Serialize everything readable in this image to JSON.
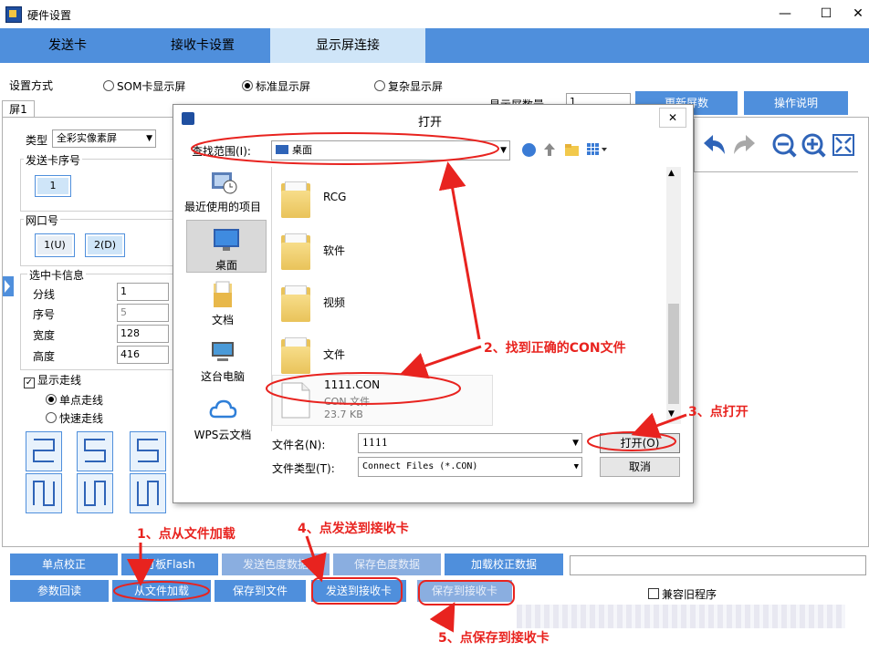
{
  "window": {
    "title": "硬件设置",
    "minimize": "—",
    "maximize": "☐",
    "close": "✕"
  },
  "tabs": [
    {
      "label": "发送卡"
    },
    {
      "label": "接收卡设置"
    },
    {
      "label": "显示屏连接"
    }
  ],
  "setup": {
    "mode_label": "设置方式",
    "modes": [
      {
        "label": "SOM卡显示屏",
        "selected": false
      },
      {
        "label": "标准显示屏",
        "selected": true
      },
      {
        "label": "复杂显示屏",
        "selected": false
      }
    ],
    "screen_count_label": "显示屏数量",
    "screen_count_value": "1",
    "btn_refresh": "更新屏数",
    "btn_help": "操作说明"
  },
  "screen_tab": "屏1",
  "left_panel": {
    "type_label": "类型",
    "type_value": "全彩实像素屏",
    "sender_group": "发送卡序号",
    "sender_value": "1",
    "port_group": "网口号",
    "port_1": "1(U)",
    "port_2": "2(D)",
    "selected_group": "选中卡信息",
    "fields": [
      {
        "label": "分线",
        "value": "1"
      },
      {
        "label": "序号",
        "value": "5"
      },
      {
        "label": "宽度",
        "value": "128"
      },
      {
        "label": "高度",
        "value": "416"
      }
    ],
    "show_wiring": "显示走线",
    "wiring_single": "单点走线",
    "wiring_fast": "快速走线"
  },
  "bottom_row1": [
    {
      "label": "单点校正",
      "enabled": true
    },
    {
      "label": "灯板Flash",
      "enabled": true
    },
    {
      "label": "发送色度数据",
      "enabled": false
    },
    {
      "label": "保存色度数据",
      "enabled": false
    },
    {
      "label": "加载校正数据",
      "enabled": true
    }
  ],
  "bottom_row2": [
    {
      "label": "参数回读",
      "enabled": true
    },
    {
      "label": "从文件加载",
      "enabled": true
    },
    {
      "label": "保存到文件",
      "enabled": true
    },
    {
      "label": "发送到接收卡",
      "enabled": true
    },
    {
      "label": "保存到接收卡",
      "enabled": false
    }
  ],
  "compat_label": "兼容旧程序",
  "dialog": {
    "title": "打开",
    "close": "✕",
    "lookin_label": "查找范围(I):",
    "lookin_value": "桌面",
    "sidebar": [
      {
        "label": "最近使用的项目",
        "icon": "recent-items-icon"
      },
      {
        "label": "桌面",
        "icon": "desktop-icon"
      },
      {
        "label": "文档",
        "icon": "documents-icon"
      },
      {
        "label": "这台电脑",
        "icon": "this-pc-icon"
      },
      {
        "label": "WPS云文档",
        "icon": "wps-cloud-icon"
      }
    ],
    "files": [
      {
        "name": "RCG",
        "kind": "folder"
      },
      {
        "name": "软件",
        "kind": "folder"
      },
      {
        "name": "视频",
        "kind": "folder"
      },
      {
        "name": "文件",
        "kind": "folder"
      }
    ],
    "selected_file": {
      "name": "1111.CON",
      "type": "CON 文件",
      "size": "23.7 KB"
    },
    "filename_label": "文件名(N):",
    "filename_value": "1111",
    "filetype_label": "文件类型(T):",
    "filetype_value": "Connect Files (*.CON)",
    "open_button": "打开(O)",
    "cancel_button": "取消"
  },
  "annotations": {
    "step1": "1、点从文件加载",
    "step2": "2、找到正确的CON文件",
    "step3": "3、点打开",
    "step4": "4、点发送到接收卡",
    "step5": "5、点保存到接收卡",
    "accent": "#e8231f"
  },
  "colors": {
    "tab_bar": "#4f8fdc",
    "tab_active": "#cfe5f8",
    "button": "#4f8fdc"
  }
}
